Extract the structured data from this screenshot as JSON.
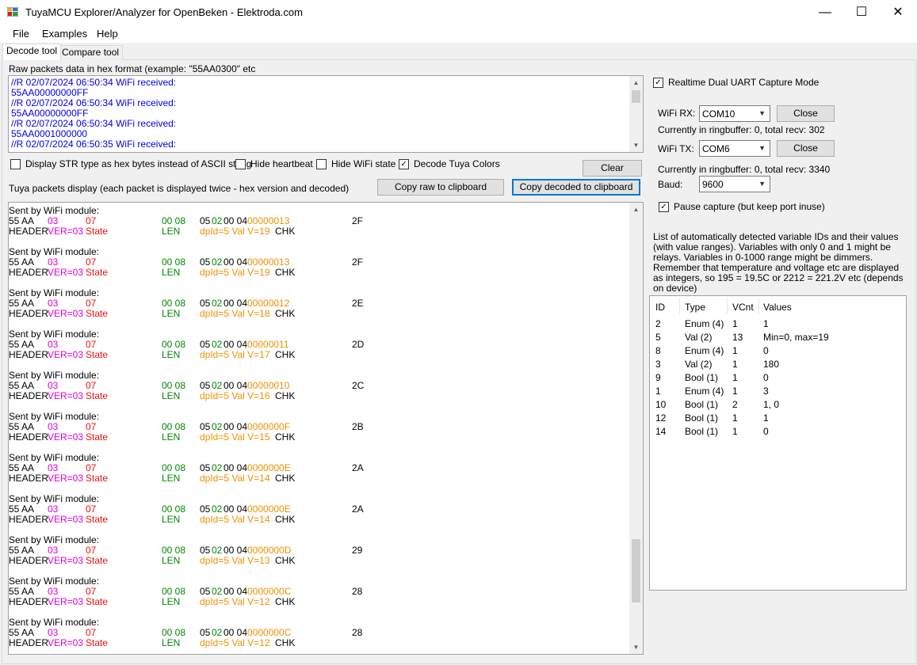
{
  "window": {
    "title": "TuyaMCU Explorer/Analyzer for OpenBeken - Elektroda.com",
    "minimize": "—",
    "maximize": "☐",
    "close": "✕"
  },
  "menu": [
    "File",
    "Examples",
    "Help"
  ],
  "tabs": [
    "Decode tool",
    "Compare tool"
  ],
  "raw": {
    "label": "Raw packets data in hex format (example: \"55AA0300\" etc",
    "lines": [
      "//R 02/07/2024 06:50:34 WiFi received:",
      "55AA00000000FF",
      "//R 02/07/2024 06:50:34 WiFi received:",
      "55AA00000000FF",
      "//R 02/07/2024 06:50:34 WiFi received:",
      "55AA0001000000",
      "//R 02/07/2024 06:50:35 WiFi received:"
    ]
  },
  "options": {
    "str_hex": {
      "label": "Display STR type as hex bytes instead of ASCII string",
      "checked": false
    },
    "hide_heartbeat": {
      "label": "Hide heartbeat",
      "checked": false
    },
    "hide_wifi": {
      "label": "Hide WiFi state",
      "checked": false
    },
    "decode_colors": {
      "label": "Decode Tuya Colors",
      "checked": true
    }
  },
  "buttons": {
    "clear": "Clear",
    "copy_raw": "Copy raw to clipboard",
    "copy_decoded": "Copy decoded to clipboard"
  },
  "packets_label": "Tuya packets display (each packet is displayed twice - hex version and decoded)",
  "packet_common": {
    "sent": "Sent by WiFi module:",
    "hdr_hex": "55 AA",
    "ver_hex": "03",
    "state_hex": "07",
    "len_hex": "00 08",
    "dp_prefix": "05",
    "dp_type": "02",
    "dp_len": "00 04",
    "hdr_lbl": "HEADER",
    "ver_lbl": "VER=03",
    "state_lbl": "State",
    "len_lbl": "LEN",
    "chk_lbl": "CHK"
  },
  "packets": [
    {
      "val": "00000013",
      "chk": "2F",
      "dp": "dpId=5 Val V=19"
    },
    {
      "val": "00000013",
      "chk": "2F",
      "dp": "dpId=5 Val V=19"
    },
    {
      "val": "00000012",
      "chk": "2E",
      "dp": "dpId=5 Val V=18"
    },
    {
      "val": "00000011",
      "chk": "2D",
      "dp": "dpId=5 Val V=17"
    },
    {
      "val": "00000010",
      "chk": "2C",
      "dp": "dpId=5 Val V=16"
    },
    {
      "val": "0000000F",
      "chk": "2B",
      "dp": "dpId=5 Val V=15"
    },
    {
      "val": "0000000E",
      "chk": "2A",
      "dp": "dpId=5 Val V=14"
    },
    {
      "val": "0000000E",
      "chk": "2A",
      "dp": "dpId=5 Val V=14"
    },
    {
      "val": "0000000D",
      "chk": "29",
      "dp": "dpId=5 Val V=13"
    },
    {
      "val": "0000000C",
      "chk": "28",
      "dp": "dpId=5 Val V=12"
    },
    {
      "val": "0000000C",
      "chk": "28",
      "dp": "dpId=5 Val V=12"
    }
  ],
  "capture": {
    "realtime": {
      "label": "Realtime Dual UART Capture Mode",
      "checked": true
    },
    "rx_label": "WiFi RX:",
    "rx_port": "COM10",
    "rx_button": "Close",
    "rx_status": "Currently in ringbuffer: 0, total recv: 302",
    "tx_label": "WiFi TX:",
    "tx_port": "COM6",
    "tx_button": "Close",
    "tx_status": "Currently in ringbuffer: 0, total recv: 3340",
    "baud_label": "Baud:",
    "baud": "9600",
    "pause": {
      "label": "Pause capture (but keep port inuse)",
      "checked": true
    }
  },
  "vars_desc": [
    "List of automatically detected variable IDs  and their values",
    "(with value ranges). Variables with only 0 and 1 might be",
    "relays. Variables in 0-1000 range might be dimmers.",
    "Remember that temperature and voltage etc are displayed",
    "as integers, so 195 = 19.5C or 2212 = 221.2V etc (depends",
    "on device)"
  ],
  "vars": {
    "columns": [
      "ID",
      "Type",
      "VCnt",
      "Values"
    ],
    "rows": [
      [
        "2",
        "Enum (4)",
        "1",
        "1"
      ],
      [
        "5",
        "Val (2)",
        "13",
        "Min=0, max=19"
      ],
      [
        "8",
        "Enum (4)",
        "1",
        "0"
      ],
      [
        "3",
        "Val (2)",
        "1",
        "180"
      ],
      [
        "9",
        "Bool (1)",
        "1",
        "0"
      ],
      [
        "1",
        "Enum (4)",
        "1",
        "3"
      ],
      [
        "10",
        "Bool (1)",
        "2",
        "1, 0"
      ],
      [
        "12",
        "Bool (1)",
        "1",
        "1"
      ],
      [
        "14",
        "Bool (1)",
        "1",
        "0"
      ]
    ]
  }
}
